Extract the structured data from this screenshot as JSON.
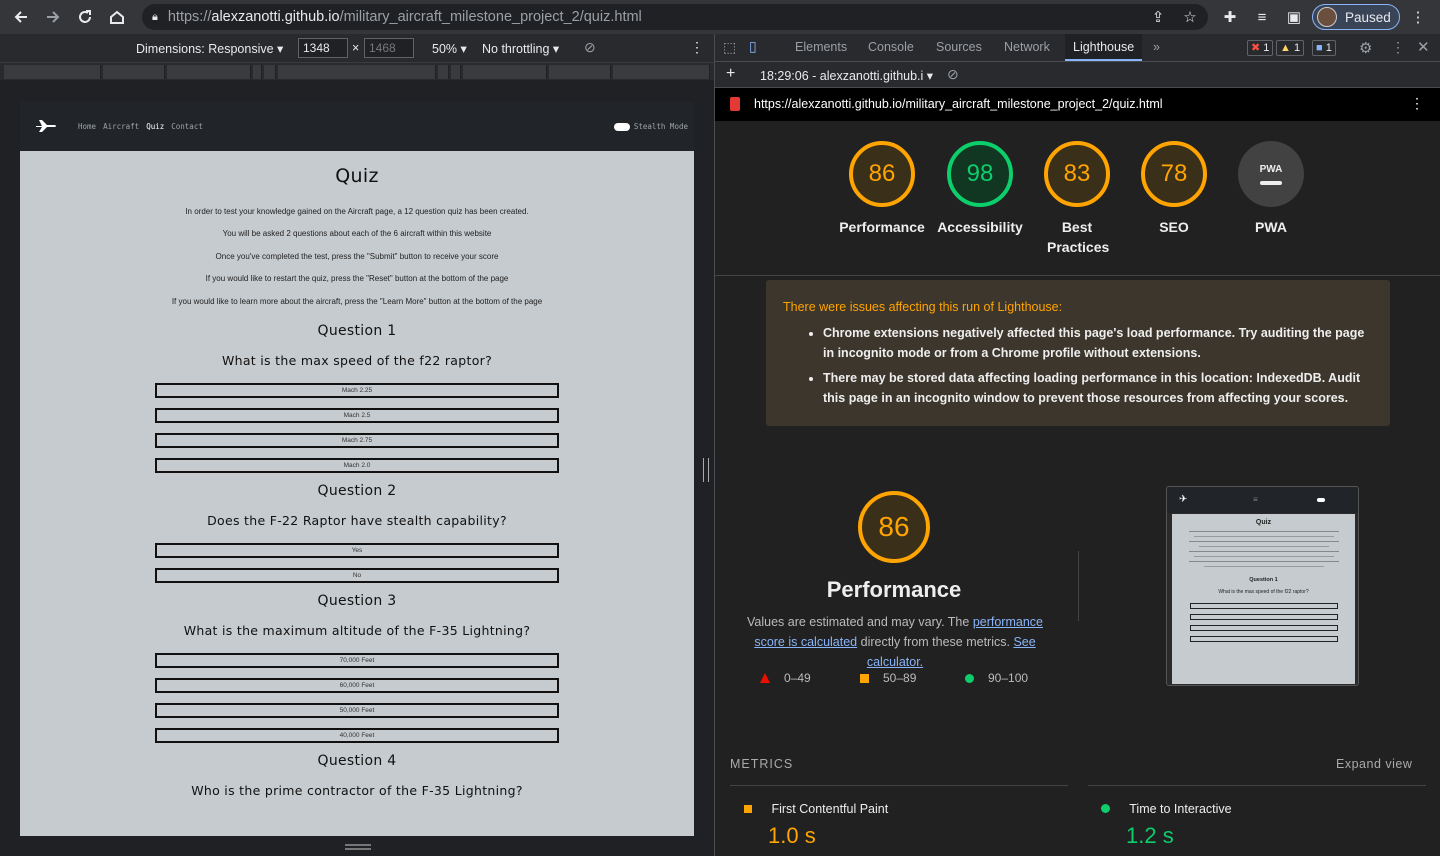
{
  "browser": {
    "url_scheme": "https://",
    "url_host": "alexzanotti.github.io",
    "url_path": "/military_aircraft_milestone_project_2/quiz.html",
    "profile_label": "Paused"
  },
  "device_toolbar": {
    "dimensions_label": "Dimensions: Responsive ▾",
    "width": "1348",
    "height": "1468",
    "times": "×",
    "zoom": "50% ▾",
    "throttle": "No throttling ▾"
  },
  "site": {
    "nav": [
      "Home",
      "Aircraft",
      "Quiz",
      "Contact"
    ],
    "stealth_label": "Stealth Mode",
    "title": "Quiz",
    "intro": [
      "In order to test your knowledge gained on the Aircraft page, a 12 question quiz has been created.",
      "You will be asked 2 questions about each of the 6 aircraft within this website",
      "Once you've completed the test, press the \"Submit\" button to receive your score",
      "If you would like to restart the quiz, press the \"Reset\" button at the bottom of the page",
      "If you would like to learn more about the aircraft, press the \"Learn More\" button at the bottom of the page"
    ],
    "questions": [
      {
        "heading": "Question 1",
        "text": "What is the max speed of the f22 raptor?",
        "options": [
          "Mach 2.25",
          "Mach 2.5",
          "Mach 2.75",
          "Mach 2.0"
        ]
      },
      {
        "heading": "Question 2",
        "text": "Does the F-22 Raptor have stealth capability?",
        "options": [
          "Yes",
          "No"
        ]
      },
      {
        "heading": "Question 3",
        "text": "What is the maximum altitude of the F-35 Lightning?",
        "options": [
          "70,000 Feet",
          "60,000 Feet",
          "50,000 Feet",
          "40,000 Feet"
        ]
      },
      {
        "heading": "Question 4",
        "text": "Who is the prime contractor of the F-35 Lightning?",
        "options": []
      }
    ]
  },
  "devtools": {
    "tabs": [
      "Elements",
      "Console",
      "Sources",
      "Network",
      "Lighthouse"
    ],
    "more": "»",
    "errors": "1",
    "warnings": "1",
    "messages": "1",
    "run_label": "18:29:06 - alexzanotti.github.i ▾",
    "report_url": "https://alexzanotti.github.io/military_aircraft_milestone_project_2/quiz.html"
  },
  "lighthouse": {
    "scores": [
      {
        "label": "Performance",
        "value": "86",
        "status": "orange"
      },
      {
        "label": "Accessibility",
        "value": "98",
        "status": "green"
      },
      {
        "label": "Best Practices",
        "value": "83",
        "status": "orange"
      },
      {
        "label": "SEO",
        "value": "78",
        "status": "orange"
      },
      {
        "label": "PWA",
        "value": "",
        "status": "gray"
      }
    ],
    "pwa_badge": "PWA",
    "warning_title": "There were issues affecting this run of Lighthouse:",
    "warnings": [
      "Chrome extensions negatively affected this page's load performance. Try auditing the page in incognito mode or from a Chrome profile without extensions.",
      "There may be stored data affecting loading performance in this location: IndexedDB. Audit this page in an incognito window to prevent those resources from affecting your scores."
    ],
    "performance_score": "86",
    "performance_title": "Performance",
    "desc_pre": "Values are estimated and may vary. The ",
    "desc_link1": "performance score is calculated",
    "desc_mid": " directly from these metrics. ",
    "desc_link2": "See calculator.",
    "legend": [
      "0–49",
      "50–89",
      "90–100"
    ],
    "metrics_heading": "METRICS",
    "expand_label": "Expand view",
    "metrics": [
      {
        "name": "First Contentful Paint",
        "value": "1.0 s",
        "status": "orange"
      },
      {
        "name": "Time to Interactive",
        "value": "1.2 s",
        "status": "green"
      }
    ],
    "thumb_title": "Quiz",
    "thumb_q": "Question 1",
    "thumb_qtext": "What is the max speed of the f22 raptor?"
  },
  "colors": {
    "orange": "#ffa400",
    "green": "#0cce6b",
    "red": "#ff4e42"
  }
}
